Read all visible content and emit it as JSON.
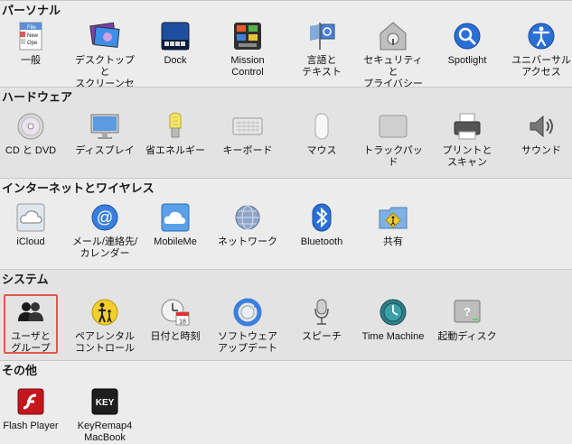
{
  "sections": [
    {
      "title": "パーソナル",
      "items": [
        {
          "label": "一般",
          "icon": "general-icon",
          "icon_text": [
            "File",
            "New",
            "Ope"
          ]
        },
        {
          "label": "デスクトップと\nスクリーンセーバ",
          "icon": "desktop-screensaver-icon"
        },
        {
          "label": "Dock",
          "icon": "dock-icon"
        },
        {
          "label": "Mission\nControl",
          "icon": "mission-control-icon"
        },
        {
          "label": "言語と\nテキスト",
          "icon": "language-text-icon"
        },
        {
          "label": "セキュリティと\nプライバシー",
          "icon": "security-privacy-icon"
        },
        {
          "label": "Spotlight",
          "icon": "spotlight-icon"
        },
        {
          "label": "ユニバーサル\nアクセス",
          "icon": "universal-access-icon"
        }
      ]
    },
    {
      "title": "ハードウェア",
      "items": [
        {
          "label": "CD と DVD",
          "icon": "cd-dvd-icon"
        },
        {
          "label": "ディスプレイ",
          "icon": "display-icon"
        },
        {
          "label": "省エネルギー",
          "icon": "energy-saver-icon"
        },
        {
          "label": "キーボード",
          "icon": "keyboard-icon"
        },
        {
          "label": "マウス",
          "icon": "mouse-icon"
        },
        {
          "label": "トラックパッド",
          "icon": "trackpad-icon"
        },
        {
          "label": "プリントと\nスキャン",
          "icon": "print-scan-icon"
        },
        {
          "label": "サウンド",
          "icon": "sound-icon"
        }
      ]
    },
    {
      "title": "インターネットとワイヤレス",
      "items": [
        {
          "label": "iCloud",
          "icon": "icloud-icon"
        },
        {
          "label": "メール/連絡先/\nカレンダー",
          "icon": "mail-contacts-calendar-icon"
        },
        {
          "label": "MobileMe",
          "icon": "mobileme-icon"
        },
        {
          "label": "ネットワーク",
          "icon": "network-icon"
        },
        {
          "label": "Bluetooth",
          "icon": "bluetooth-icon"
        },
        {
          "label": "共有",
          "icon": "sharing-icon"
        }
      ]
    },
    {
      "title": "システム",
      "items": [
        {
          "label": "ユーザと\nグループ",
          "icon": "users-groups-icon",
          "selected": true
        },
        {
          "label": "ペアレンタル\nコントロール",
          "icon": "parental-controls-icon"
        },
        {
          "label": "日付と時刻",
          "icon": "date-time-icon",
          "icon_text": [
            "18"
          ]
        },
        {
          "label": "ソフトウェア\nアップデート",
          "icon": "software-update-icon"
        },
        {
          "label": "スピーチ",
          "icon": "speech-icon"
        },
        {
          "label": "Time Machine",
          "icon": "time-machine-icon"
        },
        {
          "label": "起動ディスク",
          "icon": "startup-disk-icon"
        }
      ]
    },
    {
      "title": "その他",
      "items": [
        {
          "label": "Flash Player",
          "icon": "flash-player-icon"
        },
        {
          "label": "KeyRemap4\nMacBook",
          "icon": "keyremap4macbook-icon",
          "icon_text": [
            "KEY"
          ]
        }
      ]
    }
  ],
  "colors": {
    "highlight": "#e5574a",
    "section_alt": "#e3e3e3",
    "section_plain": "#ececec"
  }
}
